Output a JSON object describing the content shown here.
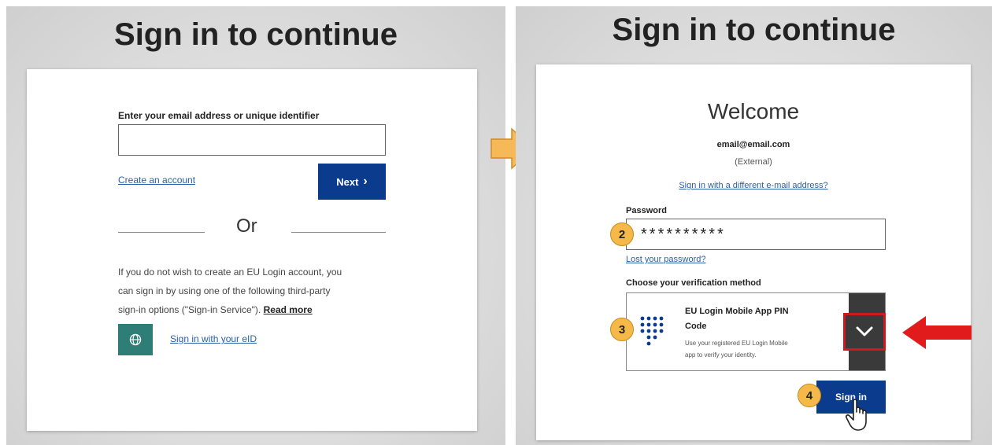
{
  "left": {
    "heading": "Sign in to continue",
    "email_label": "Enter your email address or unique identifier",
    "email_value": "",
    "create_account": "Create an account",
    "next_label": "Next",
    "next_chevron": "›",
    "or_text": "Or",
    "info_line1": "If you do not wish to create an EU Login account, you",
    "info_line2": "can sign in by using one of the following third-party",
    "info_line3": "sign-in options (\"Sign-in Service\").",
    "read_more": "Read more",
    "eid_icon": "globe-icon",
    "eid_link": "Sign in with your eID"
  },
  "arrow_icon": "right-arrow-icon",
  "right": {
    "heading": "Sign in to continue",
    "welcome": "Welcome",
    "email": "email@email.com",
    "external": "(External)",
    "different_email": "Sign in with a different e-mail address?",
    "password_label": "Password",
    "password_value": "**********",
    "lost_password": "Lost your password?",
    "verification_label": "Choose your verification method",
    "method_title_line1": "EU Login Mobile App PIN",
    "method_title_line2": "Code",
    "method_desc_line1": "Use your registered EU Login Mobile",
    "method_desc_line2": "app to verify your identity.",
    "method_icon": "keypad-icon",
    "dropdown_icon": "chevron-down-icon",
    "signin_label": "Sign in",
    "badges": [
      "2",
      "3",
      "4"
    ],
    "highlight_color": "#d0191e",
    "accent_color": "#0b3b8c",
    "badge_color": "#f5b94a"
  }
}
